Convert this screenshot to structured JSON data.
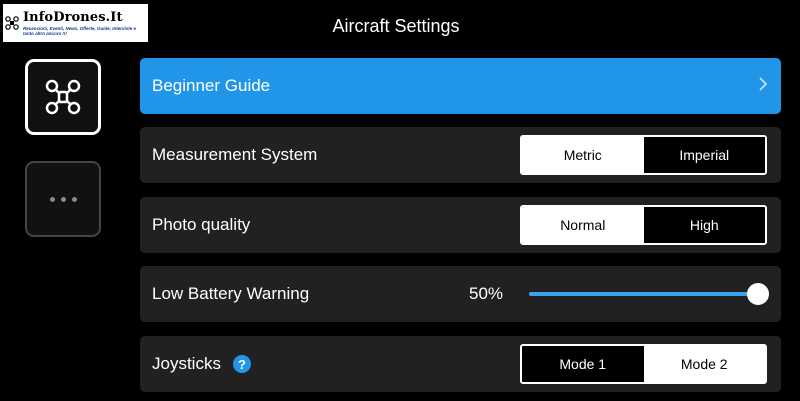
{
  "logo": {
    "title": "InfoDrones.It",
    "tagline": "Recensioni, Eventi, News, Offerte, Guide, Interviste e tanto altro ancora !!!"
  },
  "header": {
    "title": "Aircraft Settings"
  },
  "sidebar": {
    "items": [
      {
        "icon": "drone-icon",
        "active": true
      },
      {
        "icon": "more-icon",
        "active": false
      }
    ]
  },
  "settings": {
    "beginner_guide": {
      "label": "Beginner Guide",
      "icon": "chevron-right-icon"
    },
    "measurement": {
      "label": "Measurement System",
      "options": [
        "Metric",
        "Imperial"
      ],
      "selected": "Metric"
    },
    "photo_quality": {
      "label": "Photo quality",
      "options": [
        "Normal",
        "High"
      ],
      "selected": "Normal"
    },
    "low_battery": {
      "label": "Low Battery Warning",
      "value_text": "50%",
      "level": 1.0
    },
    "joysticks": {
      "label": "Joysticks",
      "help_icon": "help-icon",
      "help_text": "?",
      "options": [
        "Mode 1",
        "Mode 2"
      ],
      "selected": "Mode 2"
    }
  },
  "colors": {
    "accent": "#2196e8",
    "row_bg": "#212121",
    "slider_fill": "#3aa3f0"
  }
}
